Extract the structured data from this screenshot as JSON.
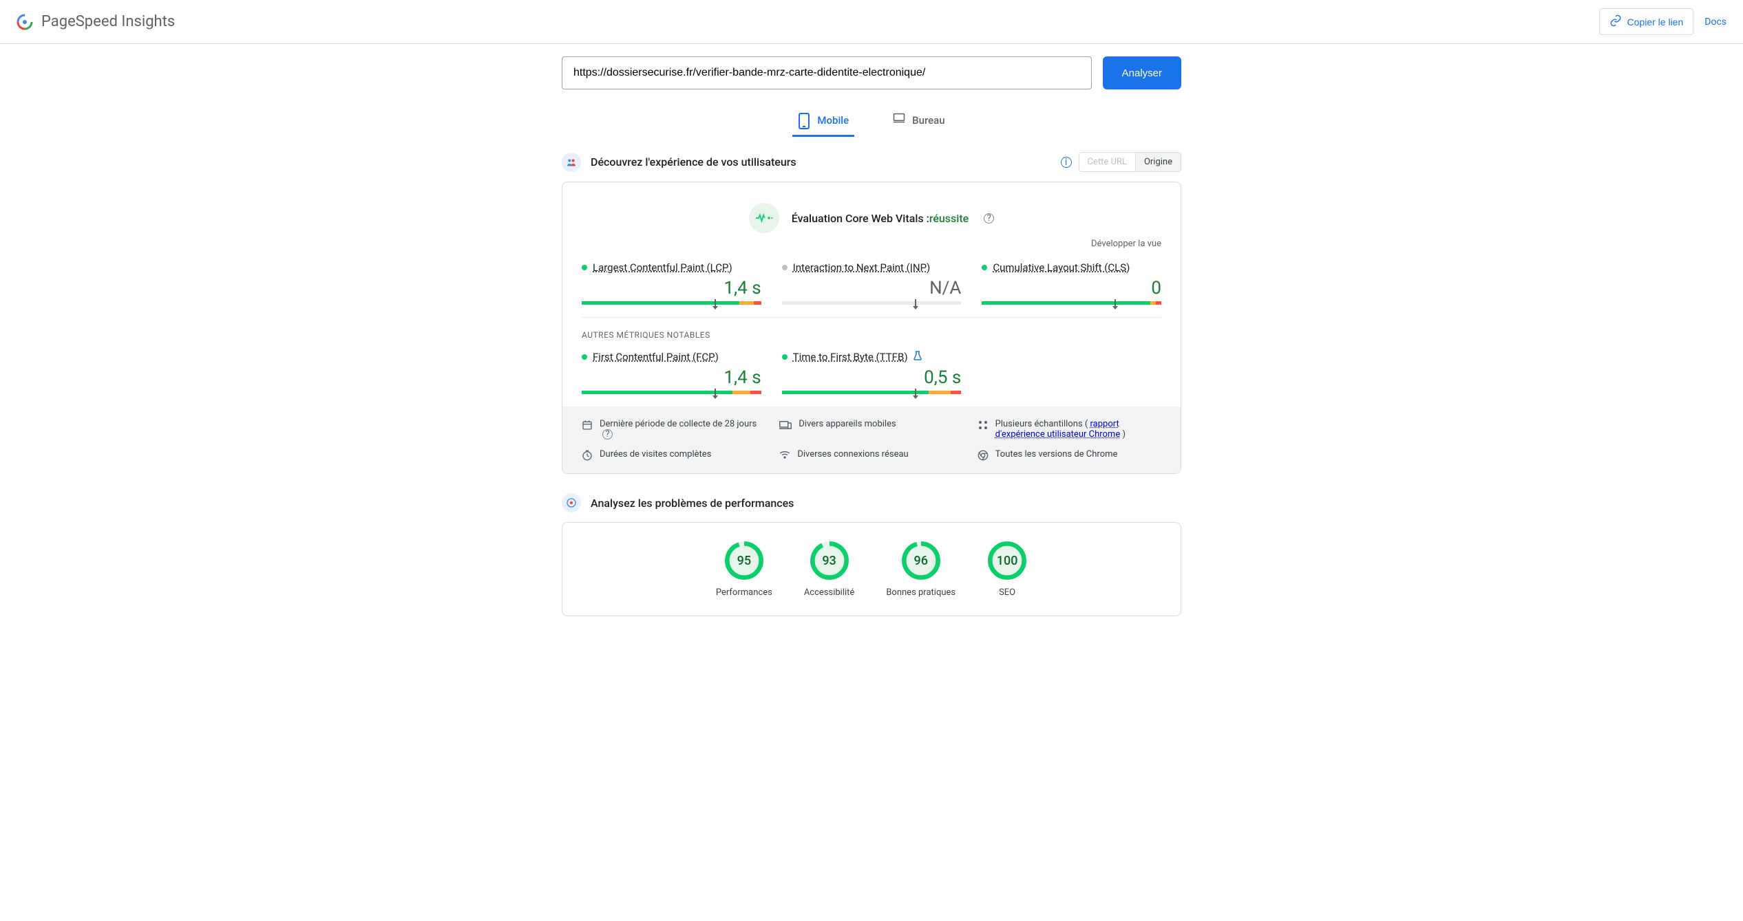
{
  "header": {
    "title": "PageSpeed Insights",
    "copy_link": "Copier le lien",
    "docs": "Docs"
  },
  "url_bar": {
    "value": "https://dossiersecurise.fr/verifier-bande-mrz-carte-didentite-electronique/",
    "analyze": "Analyser"
  },
  "tabs": {
    "mobile": "Mobile",
    "desktop": "Bureau"
  },
  "field_section": {
    "title": "Découvrez l'expérience de vos utilisateurs",
    "toggle_url": "Cette URL",
    "toggle_origin": "Origine"
  },
  "cwv": {
    "label": "Évaluation Core Web Vitals :",
    "status": "réussite",
    "expand": "Développer la vue"
  },
  "metrics": {
    "lcp_name": "Largest Contentful Paint (LCP)",
    "lcp_value": "1,4 s",
    "inp_name": "Interaction to Next Paint (INP)",
    "inp_value": "N/A",
    "cls_name": "Cumulative Layout Shift (CLS)",
    "cls_value": "0",
    "other_label": "AUTRES MÉTRIQUES NOTABLES",
    "fcp_name": "First Contentful Paint (FCP)",
    "fcp_value": "1,4 s",
    "ttfb_name": "Time to First Byte (TTFB)",
    "ttfb_value": "0,5 s"
  },
  "footer": {
    "period": "Dernière période de collecte de 28 jours",
    "devices": "Divers appareils mobiles",
    "samples_a": "Plusieurs échantillons (",
    "samples_link": "rapport d'expérience utilisateur Chrome",
    "samples_b": ")",
    "duration": "Durées de visites complètes",
    "network": "Diverses connexions réseau",
    "chrome": "Toutes les versions de Chrome"
  },
  "lab_section": {
    "title": "Analysez les problèmes de performances"
  },
  "gauges": {
    "perf": {
      "score": "95",
      "label": "Performances"
    },
    "a11y": {
      "score": "93",
      "label": "Accessibilité"
    },
    "bp": {
      "score": "96",
      "label": "Bonnes pratiques"
    },
    "seo": {
      "score": "100",
      "label": "SEO"
    }
  },
  "chart_data": {
    "type": "table",
    "title": "PageSpeed Insights — Mobile",
    "core_web_vitals_assessment": "réussite",
    "metrics": [
      {
        "name": "Largest Contentful Paint (LCP)",
        "value": "1,4 s",
        "status": "good",
        "distribution": {
          "good": 88,
          "needs_improvement": 8,
          "poor": 4
        }
      },
      {
        "name": "Interaction to Next Paint (INP)",
        "value": "N/A",
        "status": "no_data"
      },
      {
        "name": "Cumulative Layout Shift (CLS)",
        "value": "0",
        "status": "good",
        "distribution": {
          "good": 94,
          "needs_improvement": 3,
          "poor": 3
        }
      },
      {
        "name": "First Contentful Paint (FCP)",
        "value": "1,4 s",
        "status": "good",
        "distribution": {
          "good": 84,
          "needs_improvement": 10,
          "poor": 6
        }
      },
      {
        "name": "Time to First Byte (TTFB)",
        "value": "0,5 s",
        "status": "good",
        "distribution": {
          "good": 82,
          "needs_improvement": 12,
          "poor": 6
        }
      }
    ],
    "lighthouse_scores": {
      "Performances": 95,
      "Accessibilité": 93,
      "Bonnes pratiques": 96,
      "SEO": 100
    }
  }
}
